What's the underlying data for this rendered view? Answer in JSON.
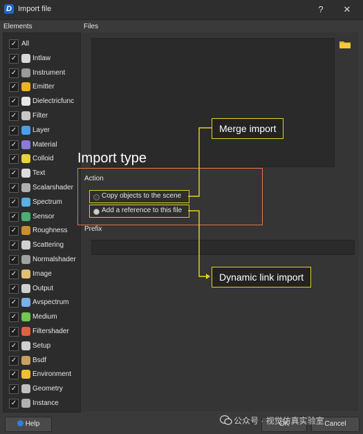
{
  "window": {
    "title": "Import file",
    "help_glyph": "?",
    "close_glyph": "✕",
    "app_logo": "D"
  },
  "elements": {
    "label": "Elements",
    "check_glyph": "✓",
    "items": [
      {
        "label": "All",
        "icon": "none",
        "color": "transparent"
      },
      {
        "label": "Intlaw",
        "icon": "feather-icon",
        "color": "#d9d9d9"
      },
      {
        "label": "Instrument",
        "icon": "instrument-icon",
        "color": "#9a9a9a"
      },
      {
        "label": "Emitter",
        "icon": "bulb-icon",
        "color": "#f0b020"
      },
      {
        "label": "Dielectricfunc",
        "icon": "epsilon-icon",
        "color": "#e6e6e6"
      },
      {
        "label": "Filter",
        "icon": "gear-icon",
        "color": "#c8c8c8"
      },
      {
        "label": "Layer",
        "icon": "layer-icon",
        "color": "#4aa0e8"
      },
      {
        "label": "Material",
        "icon": "molecule-icon",
        "color": "#8a7ad8"
      },
      {
        "label": "Colloid",
        "icon": "colloid-icon",
        "color": "#e8d040"
      },
      {
        "label": "Text",
        "icon": "text-icon",
        "color": "#dcdcdc"
      },
      {
        "label": "Scalarshader",
        "icon": "scalarshader-icon",
        "color": "#b0b0b0"
      },
      {
        "label": "Spectrum",
        "icon": "spectrum-icon",
        "color": "#5ab0e0"
      },
      {
        "label": "Sensor",
        "icon": "sensor-icon",
        "color": "#4ab070"
      },
      {
        "label": "Roughness",
        "icon": "roughness-icon",
        "color": "#c89030"
      },
      {
        "label": "Scattering",
        "icon": "cloud-icon",
        "color": "#d0d0d0"
      },
      {
        "label": "Normalshader",
        "icon": "normalshader-icon",
        "color": "#a0a0a0"
      },
      {
        "label": "Image",
        "icon": "image-icon",
        "color": "#e0c070"
      },
      {
        "label": "Output",
        "icon": "output-icon",
        "color": "#d0d0d0"
      },
      {
        "label": "Avspectrum",
        "icon": "avspectrum-icon",
        "color": "#7ab0e8"
      },
      {
        "label": "Medium",
        "icon": "drop-icon",
        "color": "#70c850"
      },
      {
        "label": "Filtershader",
        "icon": "filtershader-icon",
        "color": "#e06040"
      },
      {
        "label": "Setup",
        "icon": "tools-icon",
        "color": "#d0d0d0"
      },
      {
        "label": "Bsdf",
        "icon": "bsdf-icon",
        "color": "#c8a060"
      },
      {
        "label": "Environment",
        "icon": "sun-icon",
        "color": "#f0c030"
      },
      {
        "label": "Geometry",
        "icon": "geometry-icon",
        "color": "#c0c0c0"
      },
      {
        "label": "Instance",
        "icon": "instance-icon",
        "color": "#b0b0b0"
      }
    ]
  },
  "files": {
    "label": "Files",
    "folder_icon": "folder-icon"
  },
  "annotation": {
    "import_type": "Import type",
    "merge_import": "Merge import",
    "dynamic_link_import": "Dynamic link import",
    "border_color": "#e07a45",
    "highlight_color": "#e6d020"
  },
  "action": {
    "label": "Action",
    "copy_label": "Copy objects to the scene",
    "reference_label": "Add a reference to this file",
    "selected": "reference"
  },
  "prefix": {
    "label": "Prefix",
    "value": ""
  },
  "buttons": {
    "help": "Help",
    "ok": "OK",
    "cancel": "Cancel"
  },
  "watermark": {
    "text": "公众号 · 视觉仿真实验室"
  }
}
